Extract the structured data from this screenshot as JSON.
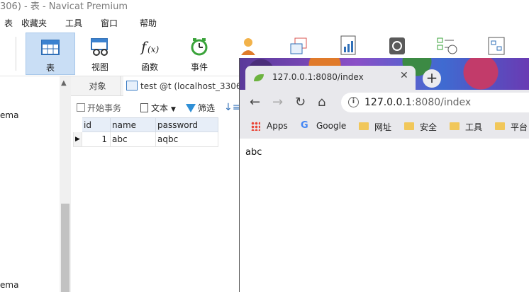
{
  "navicat": {
    "title": "306) - 表 - Navicat Premium",
    "menu": [
      "表",
      "收藏夹",
      "工具",
      "窗口",
      "帮助"
    ],
    "toolbar": [
      {
        "label": "表",
        "icon": "table-icon",
        "active": true
      },
      {
        "label": "视图",
        "icon": "view-icon",
        "active": false
      },
      {
        "label": "函数",
        "icon": "function-icon",
        "active": false
      },
      {
        "label": "事件",
        "icon": "event-clock-icon",
        "active": false
      }
    ],
    "tree": [
      "ema",
      "ema"
    ],
    "object_tab": "对象",
    "query_tab": "test @t (localhost_3306)",
    "grid_toolbar": {
      "begin_transaction": "开始事务",
      "text": "文本",
      "filter": "筛选"
    },
    "table": {
      "columns": [
        "id",
        "name",
        "password"
      ],
      "rows": [
        {
          "id": "1",
          "name": "abc",
          "password": "aqbc"
        }
      ]
    }
  },
  "chrome": {
    "tab_title": "127.0.0.1:8080/index",
    "url_host": "127.0.0.1",
    "url_path": ":8080/index",
    "bookmarks": [
      "Apps",
      "Google",
      "网址",
      "安全",
      "工具",
      "平台"
    ],
    "page_text": "abc"
  }
}
